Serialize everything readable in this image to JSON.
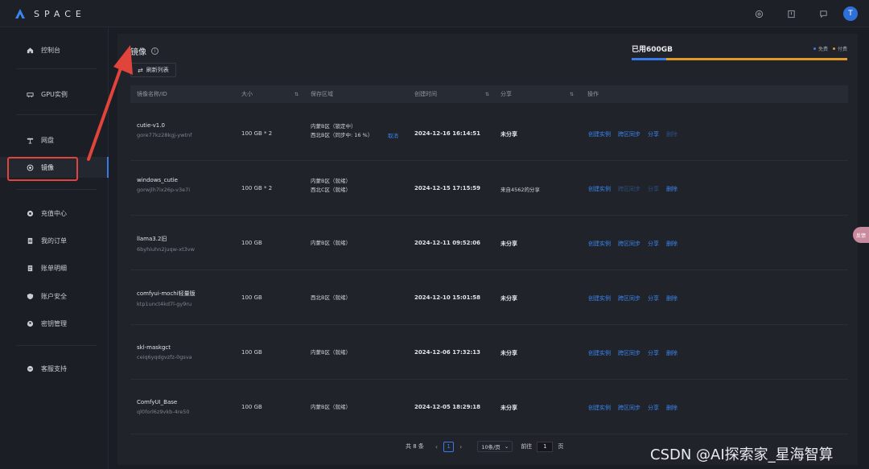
{
  "app": {
    "logo_text": "SPACE",
    "avatar_letter": "T"
  },
  "sidebar": {
    "items": [
      {
        "label": "控制台",
        "icon": "home-icon"
      },
      {
        "label": "GPU实例",
        "icon": "gpu-icon"
      },
      {
        "label": "网盘",
        "icon": "disk-icon"
      },
      {
        "label": "镜像",
        "icon": "image-icon",
        "active": true
      },
      {
        "label": "充值中心",
        "icon": "recharge-icon"
      },
      {
        "label": "我的订单",
        "icon": "order-icon"
      },
      {
        "label": "账单明细",
        "icon": "bill-icon"
      },
      {
        "label": "账户安全",
        "icon": "shield-icon"
      },
      {
        "label": "密钥管理",
        "icon": "key-icon"
      },
      {
        "label": "客服支持",
        "icon": "chat-icon"
      }
    ]
  },
  "page": {
    "title": "镜像",
    "refresh_label": "刷新列表"
  },
  "quota": {
    "label": "已用600GB",
    "legend_free": "免费",
    "legend_paid": "付费",
    "free_color": "#3a7bea",
    "paid_color": "#e09a2a",
    "free_fraction": 0.16
  },
  "table": {
    "headers": {
      "name": "镜像名称/ID",
      "size": "大小",
      "region": "保存区域",
      "created": "创建时间",
      "share": "分享",
      "ops": "操作"
    },
    "op_labels": {
      "create": "创建实例",
      "sync": "跨区同步",
      "share": "分享",
      "delete": "删除"
    },
    "rows": [
      {
        "name": "cutie-v1.0",
        "id": "gore77kz28kgj-ywtnf",
        "size": "100 GB * 2",
        "region1": "内蒙B区（锁定中）",
        "region2": "西北B区（同步中: 16 %）",
        "cancel": "取消",
        "created": "2024-12-16 16:14:51",
        "share": "未分享"
      },
      {
        "name": "windows_cutie",
        "id": "gorwjlh7ix26p-v3e7i",
        "size": "100 GB * 2",
        "region1": "内蒙B区（就绪）",
        "region2": "西北C区（就绪）",
        "cancel": "",
        "created": "2024-12-15 17:15:59",
        "share": "来自4562的分享"
      },
      {
        "name": "llama3.2旧",
        "id": "6byhiuhn2juqw-xt3vw",
        "size": "100 GB",
        "region1": "内蒙B区（就绪）",
        "region2": "",
        "cancel": "",
        "created": "2024-12-11 09:52:06",
        "share": "未分享"
      },
      {
        "name": "comfyui-mochi轻量版",
        "id": "ktp1unct4kd7l-gy9ru",
        "size": "100 GB",
        "region1": "西北B区（就绪）",
        "region2": "",
        "cancel": "",
        "created": "2024-12-10 15:01:58",
        "share": "未分享"
      },
      {
        "name": "skl-maskgct",
        "id": "ceiq6yqdgvzfz-0gsva",
        "size": "100 GB",
        "region1": "内蒙B区（就绪）",
        "region2": "",
        "cancel": "",
        "created": "2024-12-06 17:32:13",
        "share": "未分享"
      },
      {
        "name": "ComfyUI_Base",
        "id": "ql0forl6z9vkb-4re50",
        "size": "100 GB",
        "region1": "内蒙B区（就绪）",
        "region2": "",
        "cancel": "",
        "created": "2024-12-05 18:29:18",
        "share": "未分享"
      }
    ]
  },
  "pagination": {
    "total": "共 8 条",
    "current_page": "1",
    "page_size": "10条/页",
    "goto_label": "前往",
    "goto_value": "1",
    "page_suffix": "页"
  },
  "watermark": "CSDN @AI探索家_星海智算",
  "side_tab": "反馈"
}
